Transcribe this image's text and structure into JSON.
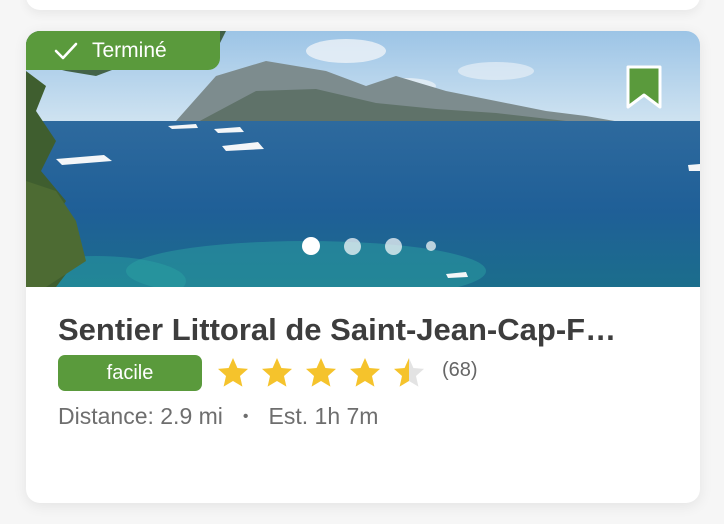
{
  "trail": {
    "status_label": "Terminé",
    "title": "Sentier Littoral de Saint-Jean-Cap-F…",
    "difficulty": "facile",
    "rating": 4.5,
    "rating_max": 5,
    "reviews": "(68)",
    "distance": "Distance: 2.9 mi",
    "separator": "•",
    "estimate": "Est. 1h 7m"
  },
  "carousel": {
    "total": 4,
    "active": 1
  },
  "colors": {
    "accent_green": "#5a9a3c",
    "star_gold": "#f5c32c",
    "star_empty": "#e3e3e3",
    "title_text": "#3d3d3d"
  },
  "icons": {
    "status": "check-icon",
    "bookmark": "bookmark-icon",
    "rating": "star-icon"
  }
}
